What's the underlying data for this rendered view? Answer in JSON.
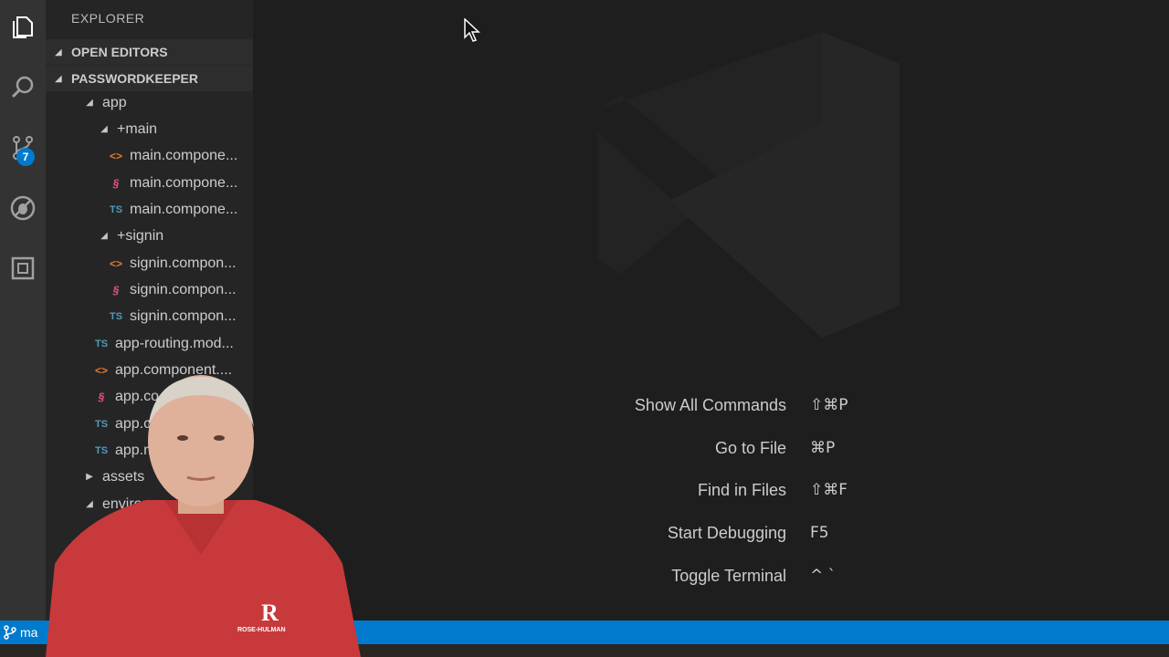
{
  "activity_bar": {
    "icons": [
      "files-icon",
      "search-icon",
      "source-control-icon",
      "debug-icon",
      "extensions-icon"
    ],
    "scm_badge": "7"
  },
  "sidebar": {
    "title": "EXPLORER",
    "open_editors": "OPEN EDITORS",
    "project": "PASSWORDKEEPER",
    "tree": [
      {
        "label": "app",
        "type": "folder",
        "expanded": true
      },
      {
        "label": "+main",
        "type": "folder",
        "expanded": true
      },
      {
        "label": "main.compone...",
        "type": "html"
      },
      {
        "label": "main.compone...",
        "type": "css"
      },
      {
        "label": "main.compone...",
        "type": "ts"
      },
      {
        "label": "+signin",
        "type": "folder",
        "expanded": true
      },
      {
        "label": "signin.compon...",
        "type": "html"
      },
      {
        "label": "signin.compon...",
        "type": "css"
      },
      {
        "label": "signin.compon...",
        "type": "ts"
      },
      {
        "label": "app-routing.mod...",
        "type": "ts"
      },
      {
        "label": "app.component....",
        "type": "html"
      },
      {
        "label": "app.co",
        "type": "css"
      },
      {
        "label": "app.co",
        "type": "ts"
      },
      {
        "label": "app.m",
        "type": "ts"
      },
      {
        "label": "assets",
        "type": "folder",
        "expanded": false
      },
      {
        "label": "environ",
        "type": "folder",
        "expanded": true
      }
    ],
    "icon_text": {
      "html": "<>",
      "css": "§",
      "ts": "TS"
    }
  },
  "editor": {
    "shortcuts": [
      {
        "label": "Show All Commands",
        "keys": "⇧⌘P"
      },
      {
        "label": "Go to File",
        "keys": "⌘P"
      },
      {
        "label": "Find in Files",
        "keys": "⇧⌘F"
      },
      {
        "label": "Start Debugging",
        "keys": "F5"
      },
      {
        "label": "Toggle Terminal",
        "keys": "^ `"
      }
    ]
  },
  "status_bar": {
    "branch": "ma"
  },
  "presenter": {
    "shirt_logo": "R",
    "shirt_text": "ROSE-HULMAN"
  },
  "colors": {
    "accent": "#007acc",
    "editor_bg": "#1e1e1e",
    "sidebar_bg": "#252526",
    "activity_bg": "#333333"
  }
}
